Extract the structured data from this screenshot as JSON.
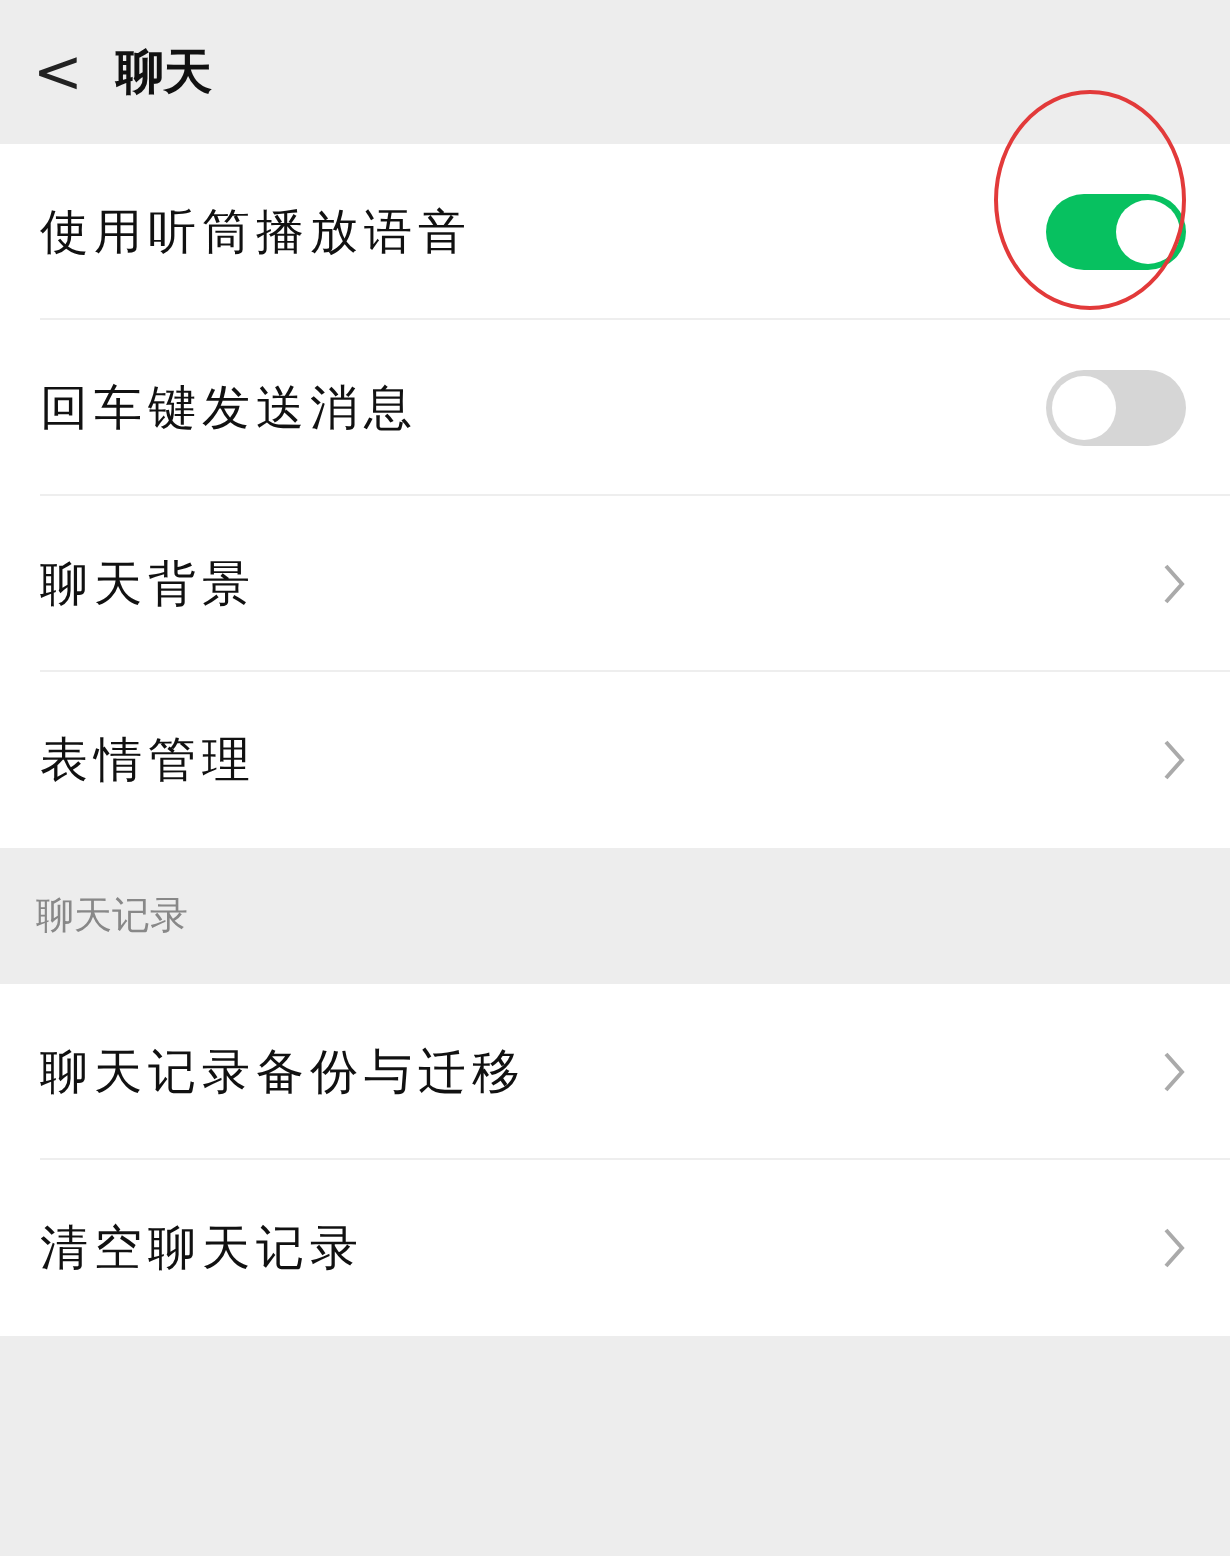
{
  "header": {
    "back": "<",
    "title": "聊天"
  },
  "sections": [
    {
      "items": [
        {
          "kind": "toggle",
          "label": "使用听筒播放语音",
          "on": true,
          "highlighted": true
        },
        {
          "kind": "toggle",
          "label": "回车键发送消息",
          "on": false,
          "highlighted": false
        },
        {
          "kind": "link",
          "label": "聊天背景"
        },
        {
          "kind": "link",
          "label": "表情管理"
        }
      ]
    },
    {
      "title": "聊天记录",
      "items": [
        {
          "kind": "link",
          "label": "聊天记录备份与迁移"
        },
        {
          "kind": "link",
          "label": "清空聊天记录"
        }
      ]
    }
  ]
}
